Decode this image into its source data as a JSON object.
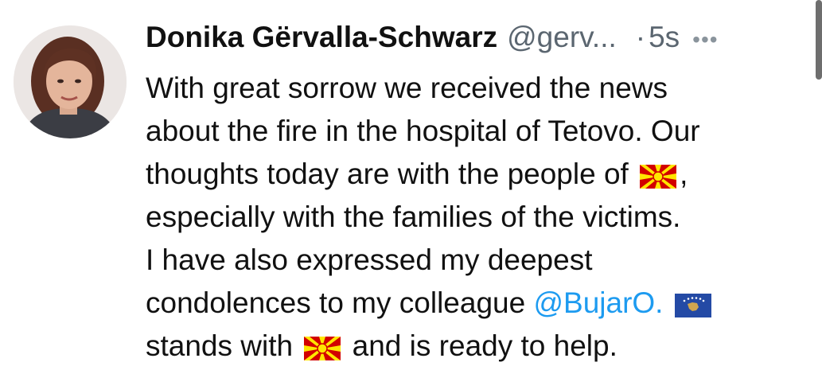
{
  "author": {
    "name": "Donika Gërvalla-Schwarz",
    "handle": "@gerv...",
    "separator": "·",
    "time": "5s"
  },
  "more_label": "•••",
  "tweet": {
    "line1": "With great sorrow we received the news",
    "line2": "about the fire in the hospital of Tetovo. Our",
    "line3_a": "thoughts today are with the people of",
    "line3_b": ",",
    "line4": "especially with the families of the victims.",
    "line5": "I have also expressed my deepest",
    "line6_a": "condolences to my colleague ",
    "mention": "@BujarO.",
    "line7_a": "stands with ",
    "line7_b": " and is ready to help."
  },
  "icons": {
    "avatar": "profile-photo",
    "flag_mk": "north-macedonia-flag",
    "flag_xk": "kosovo-flag"
  },
  "colors": {
    "mention": "#1d9bf0",
    "secondary_text": "#5b6670",
    "text": "#111111"
  }
}
